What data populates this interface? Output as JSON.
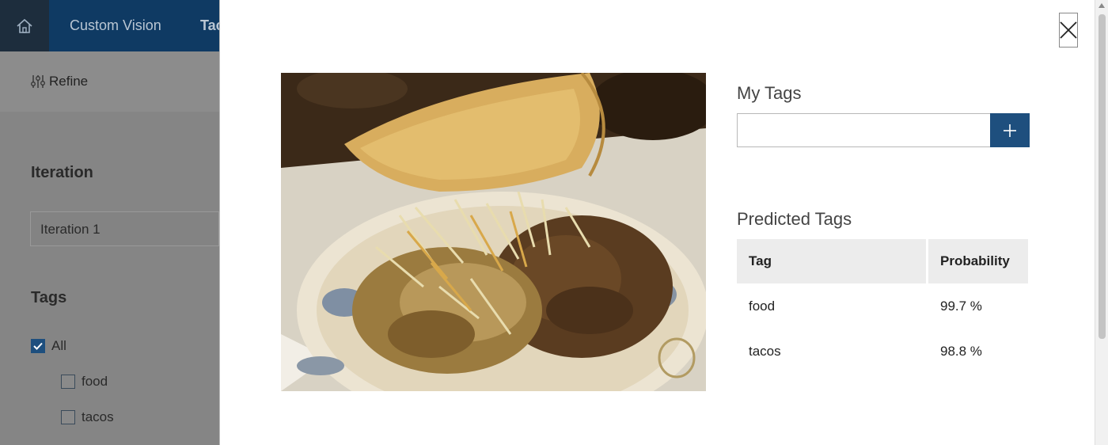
{
  "header": {
    "app_title": "Custom Vision",
    "tab_partial": "Tac",
    "home_icon": "home-icon"
  },
  "sidebar": {
    "refine_label": "Refine",
    "refine_icon": "sliders-icon",
    "iteration_title": "Iteration",
    "iteration_value": "Iteration 1",
    "tags_title": "Tags",
    "tags": [
      {
        "label": "All",
        "checked": true
      },
      {
        "label": "food",
        "checked": false
      },
      {
        "label": "tacos",
        "checked": false
      }
    ]
  },
  "modal": {
    "close_icon": "close-icon",
    "image_description_icon": "food-photo",
    "my_tags_label": "My Tags",
    "tag_input_value": "",
    "add_icon": "plus-icon",
    "predicted_label": "Predicted Tags",
    "table": {
      "headers": [
        "Tag",
        "Probability"
      ],
      "rows": [
        {
          "tag": "food",
          "probability": "99.7 %"
        },
        {
          "tag": "tacos",
          "probability": "98.8 %"
        }
      ]
    }
  },
  "colors": {
    "accent": "#1e4f7e",
    "topbar": "#0f3a63",
    "overlay": "#7a7a7a"
  }
}
